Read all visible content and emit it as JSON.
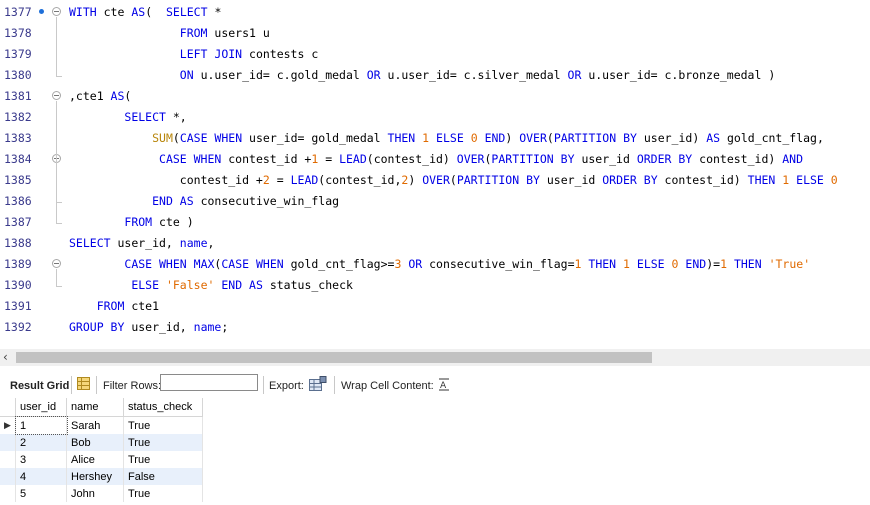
{
  "editor": {
    "lines": [
      {
        "num": "1377",
        "html": "<span class=\"kw\">WITH</span> cte <span class=\"kw\">AS</span>(  <span class=\"kw\">SELECT</span> *"
      },
      {
        "num": "1378",
        "html": "                <span class=\"kw\">FROM</span> users1 u"
      },
      {
        "num": "1379",
        "html": "                <span class=\"kw\">LEFT JOIN</span> contests c"
      },
      {
        "num": "1380",
        "html": "                <span class=\"kw\">ON</span> u.user_id= c.gold_medal <span class=\"kw\">OR</span> u.user_id= c.silver_medal <span class=\"kw\">OR</span> u.user_id= c.bronze_medal )"
      },
      {
        "num": "1381",
        "html": ",cte1 <span class=\"kw\">AS</span>("
      },
      {
        "num": "1382",
        "html": "        <span class=\"kw\">SELECT</span> *,"
      },
      {
        "num": "1383",
        "html": "            <span class=\"fn\">SUM</span>(<span class=\"kw\">CASE WHEN</span> user_id= gold_medal <span class=\"kw\">THEN</span> <span class=\"num\">1</span> <span class=\"kw\">ELSE</span> <span class=\"num\">0</span> <span class=\"kw\">END</span>) <span class=\"kw\">OVER</span>(<span class=\"kw\">PARTITION BY</span> user_id) <span class=\"kw\">AS</span> gold_cnt_flag,"
      },
      {
        "num": "1384",
        "html": "             <span class=\"kw\">CASE WHEN</span> contest_id +<span class=\"num\">1</span> = <span class=\"kw\">LEAD</span>(contest_id) <span class=\"kw\">OVER</span>(<span class=\"kw\">PARTITION BY</span> user_id <span class=\"kw\">ORDER BY</span> contest_id) <span class=\"kw\">AND</span>"
      },
      {
        "num": "1385",
        "html": "                contest_id +<span class=\"num\">2</span> = <span class=\"kw\">LEAD</span>(contest_id,<span class=\"num\">2</span>) <span class=\"kw\">OVER</span>(<span class=\"kw\">PARTITION BY</span> user_id <span class=\"kw\">ORDER BY</span> contest_id) <span class=\"kw\">THEN</span> <span class=\"num\">1</span> <span class=\"kw\">ELSE</span> <span class=\"num\">0</span>"
      },
      {
        "num": "1386",
        "html": "            <span class=\"kw\">END AS</span> consecutive_win_flag"
      },
      {
        "num": "1387",
        "html": "        <span class=\"kw\">FROM</span> cte )"
      },
      {
        "num": "1388",
        "html": "<span class=\"kw\">SELECT</span> user_id, <span class=\"kw\">name</span>,"
      },
      {
        "num": "1389",
        "html": "        <span class=\"kw\">CASE WHEN</span> <span class=\"kw\">MAX</span>(<span class=\"kw\">CASE WHEN</span> gold_cnt_flag&gt;=<span class=\"num\">3</span> <span class=\"kw\">OR</span> consecutive_win_flag=<span class=\"num\">1</span> <span class=\"kw\">THEN</span> <span class=\"num\">1</span> <span class=\"kw\">ELSE</span> <span class=\"num\">0</span> <span class=\"kw\">END</span>)=<span class=\"num\">1</span> <span class=\"kw\">THEN</span> <span class=\"str\">'True'</span>"
      },
      {
        "num": "1390",
        "html": "         <span class=\"kw\">ELSE</span> <span class=\"str\">'False'</span> <span class=\"kw\">END AS</span> status_check"
      },
      {
        "num": "1391",
        "html": "    <span class=\"kw\">FROM</span> cte1"
      },
      {
        "num": "1392",
        "html": "<span class=\"kw\">GROUP BY</span> user_id, <span class=\"kw\">name</span>;"
      }
    ]
  },
  "toolbar": {
    "result_grid_label": "Result Grid",
    "filter_rows_label": "Filter Rows:",
    "filter_value": "",
    "export_label": "Export:",
    "wrap_label": "Wrap Cell Content:",
    "grid_icon": "grid-icon",
    "export_icon": "export-icon",
    "wrap_icon": "wrap-text-icon"
  },
  "grid": {
    "columns": [
      "user_id",
      "name",
      "status_check"
    ],
    "rows": [
      [
        "1",
        "Sarah",
        "True"
      ],
      [
        "2",
        "Bob",
        "True"
      ],
      [
        "3",
        "Alice",
        "True"
      ],
      [
        "4",
        "Hershey",
        "False"
      ],
      [
        "5",
        "John",
        "True"
      ]
    ]
  },
  "colors": {
    "keyword": "#0000e6",
    "function": "#b8860b",
    "number": "#e06a00",
    "alt_row": "#e8f0fb"
  }
}
